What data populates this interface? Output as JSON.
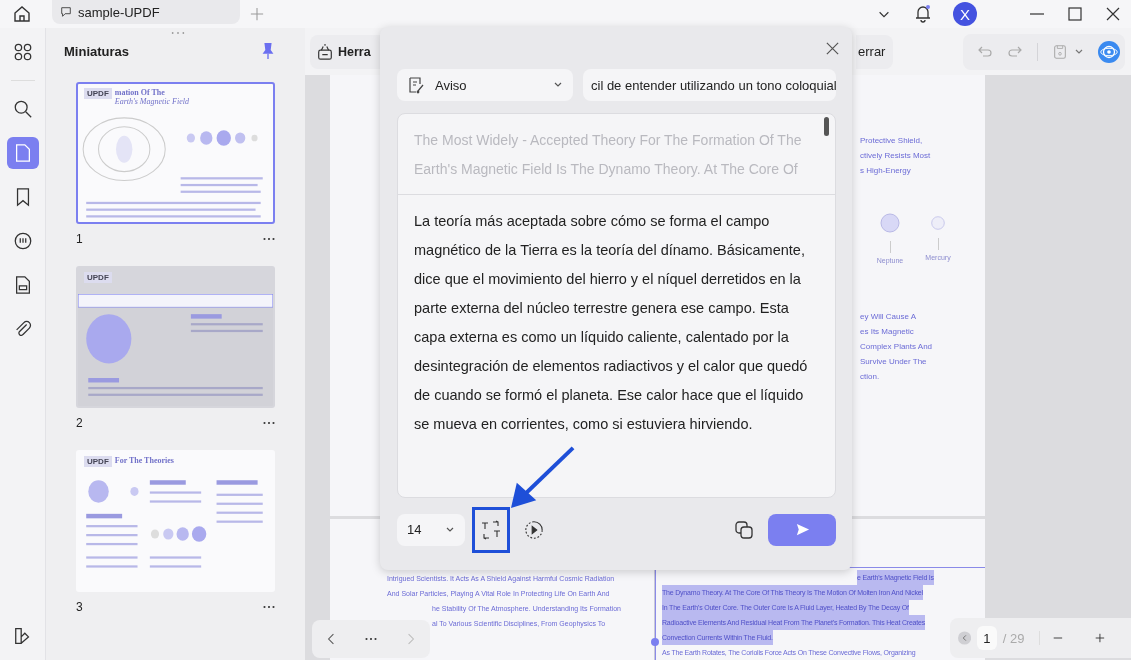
{
  "top_bar": {
    "tab_title": "sample-UPDF",
    "avatar": "X"
  },
  "rail": [
    {
      "kind": "grid",
      "selected": false
    },
    {
      "kind": "search",
      "selected": false
    },
    {
      "kind": "page",
      "selected": true
    },
    {
      "kind": "bookmark",
      "selected": false
    },
    {
      "kind": "comment",
      "selected": false
    },
    {
      "kind": "stamp",
      "selected": false
    },
    {
      "kind": "clip",
      "selected": false
    }
  ],
  "thumbnails": {
    "title": "Miniaturas",
    "pages": [
      {
        "number": "1",
        "selected": true,
        "kind": "planets",
        "logo": "UPDF",
        "heading_lines": [
          "mation Of The",
          "Earth's Magnetic Field"
        ]
      },
      {
        "number": "2",
        "selected": false,
        "kind": "layers",
        "logo": "UPDF"
      },
      {
        "number": "3",
        "selected": false,
        "kind": "theories",
        "logo": "UPDF",
        "heading_lines": [
          "For The Theories"
        ]
      }
    ]
  },
  "toolbar": {
    "left_button": "Herra",
    "right_button": "errar"
  },
  "document": {
    "page1": {
      "lines_top": [
        "Protective Shield,",
        "ctively Resists Most",
        "s High-Energy"
      ],
      "planets": [
        {
          "name": "Neptune",
          "kind": "large"
        },
        {
          "name": "Mercury",
          "kind": "small"
        }
      ],
      "lines_bottom": [
        "ey Will Cause A",
        "es Its Magnetic",
        "Complex Plants And",
        "Survive Under The",
        "ction."
      ]
    },
    "page2": {
      "left_lines": [
        {
          "text": "Intrigued Scientists. It Acts As A Shield Against Harmful Cosmic Radiation",
          "kind": "full"
        },
        {
          "text": "And Solar Particles, Playing A Vital Role In Protecting Life On Earth And",
          "kind": "full"
        },
        {
          "text": "he Stability Of The Atmosphere. Understanding Its Formation",
          "kind": "cut"
        },
        {
          "text": "al To Various Scientific Disciplines, From Geophysics To",
          "kind": "cut"
        }
      ],
      "highlight_lines": [
        {
          "text": "e Earth's Magnetic Field Is",
          "kind": "cut"
        },
        {
          "text": "The Dynamo Theory. At The Core Of This Theory Is The Motion Of Molten Iron And Nickel",
          "kind": "full"
        },
        {
          "text": "In The Earth's Outer Core. The Outer Core Is A Fluid Layer, Heated By The Decay Of",
          "kind": "full"
        },
        {
          "text": "Radioactive Elements And Residual Heat From The Planet's Formation. This Heat Creates",
          "kind": "full"
        },
        {
          "text": "Convection Currents Within The Fluid.",
          "kind": "full"
        }
      ],
      "after_line": "As The Earth Rotates, The Coriolis Force Acts On These Convective Flows, Organizing"
    }
  },
  "modal": {
    "mode": "Aviso",
    "prompt": "cil de entender utilizando un tono coloquial",
    "source_text": "The Most Widely - Accepted Theory For The Formation Of The Earth's Magnetic Field Is The Dynamo Theory. At The Core Of",
    "result_text": "La teoría más aceptada sobre cómo se forma el campo magnético de la Tierra es la teoría del dínamo. Básicamente, dice que el movimiento del hierro y el níquel derretidos en la parte externa del núcleo terrestre genera ese campo. Esta capa externa es como un líquido caliente, calentado por la desintegración de elementos radiactivos y el calor que quedó de cuando se formó el planeta. Ese calor hace que el líquido se mueva en corrientes, como si estuviera hirviendo.",
    "font_size": "14",
    "swap_tool_highlighted": true
  },
  "page_nav": {
    "page": "1",
    "total": "/ 29"
  }
}
